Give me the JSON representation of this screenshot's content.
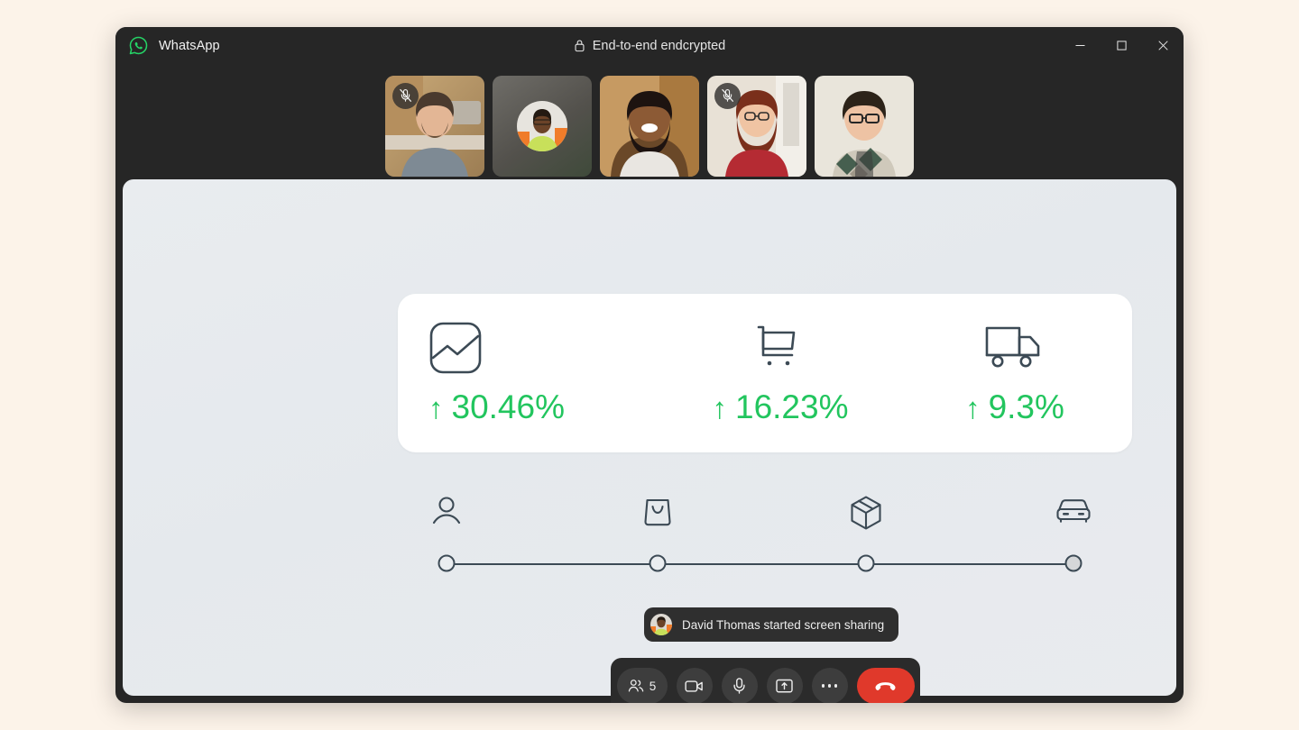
{
  "app": {
    "name": "WhatsApp",
    "logo_icon": "whatsapp-logo-icon",
    "encryption_label": "End-to-end endcrypted",
    "lock_icon": "lock-icon"
  },
  "window_controls": [
    {
      "name": "minimize",
      "icon": "minimize-icon"
    },
    {
      "name": "maximize",
      "icon": "maximize-icon"
    },
    {
      "name": "close",
      "icon": "close-icon"
    }
  ],
  "participants": [
    {
      "name": "participant-1",
      "muted": true,
      "camera_on": true,
      "mic_icon": "mic-off-icon"
    },
    {
      "name": "participant-2",
      "muted": false,
      "camera_on": false,
      "mic_icon": ""
    },
    {
      "name": "participant-3",
      "muted": false,
      "camera_on": true,
      "mic_icon": ""
    },
    {
      "name": "participant-4",
      "muted": true,
      "camera_on": true,
      "mic_icon": "mic-off-icon"
    },
    {
      "name": "participant-5",
      "muted": false,
      "camera_on": true,
      "mic_icon": ""
    }
  ],
  "shared_screen": {
    "metrics": [
      {
        "icon": "chart-image-icon",
        "trend": "↑",
        "value": "30.46%"
      },
      {
        "icon": "shopping-cart-icon",
        "trend": "↑",
        "value": "16.23%"
      },
      {
        "icon": "delivery-truck-icon",
        "trend": "↑",
        "value": "9.3%"
      }
    ],
    "funnel": {
      "steps": [
        {
          "icon": "user-icon",
          "position_pct": 2,
          "filled": false
        },
        {
          "icon": "shopping-bag-icon",
          "position_pct": 34.5,
          "filled": false
        },
        {
          "icon": "package-box-icon",
          "position_pct": 66.5,
          "filled": false
        },
        {
          "icon": "car-icon",
          "position_pct": 98.5,
          "filled": true
        }
      ]
    }
  },
  "toast": {
    "avatar_icon": "participant-avatar",
    "message": "David Thomas started screen sharing"
  },
  "controls": [
    {
      "name": "participants-button",
      "icon": "people-icon",
      "label": "5"
    },
    {
      "name": "camera-button",
      "icon": "video-camera-icon",
      "label": ""
    },
    {
      "name": "microphone-button",
      "icon": "microphone-icon",
      "label": ""
    },
    {
      "name": "share-screen-button",
      "icon": "share-screen-icon",
      "label": ""
    },
    {
      "name": "more-options-button",
      "icon": "more-horizontal-icon",
      "label": ""
    },
    {
      "name": "end-call-button",
      "icon": "hang-up-icon",
      "label": ""
    }
  ],
  "colors": {
    "page_background": "#FCF3E9",
    "window_background": "#262626",
    "brand_green": "#25D366",
    "trend_green": "#22C55E",
    "end_call_red": "#E0392B",
    "share_background": "#E7EAEE",
    "icon_stroke": "#3C4A55"
  }
}
